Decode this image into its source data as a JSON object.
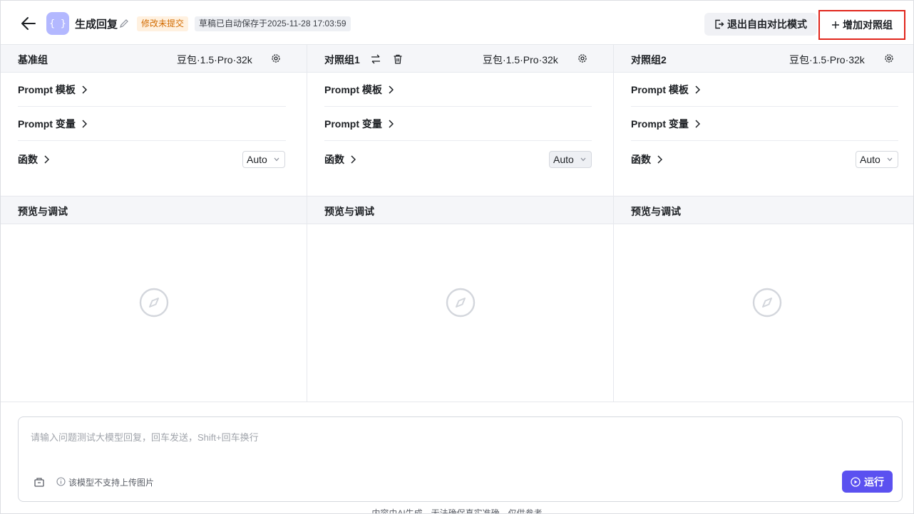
{
  "header": {
    "title": "生成回复",
    "app_icon_text": "{ }",
    "status_badge": "修改未提交",
    "draft_badge": "草稿已自动保存于2025-11-28 17:03:59",
    "exit_button": "退出自由对比模式",
    "add_button": "增加对照组"
  },
  "columns": [
    {
      "name": "基准组",
      "model": "豆包·1.5·Pro·32k",
      "rows": {
        "template": "Prompt 模板",
        "variables": "Prompt 变量",
        "functions": "函数"
      },
      "select_value": "Auto",
      "preview_title": "预览与调试"
    },
    {
      "name": "对照组1",
      "model": "豆包·1.5·Pro·32k",
      "rows": {
        "template": "Prompt 模板",
        "variables": "Prompt 变量",
        "functions": "函数"
      },
      "select_value": "Auto",
      "preview_title": "预览与调试"
    },
    {
      "name": "对照组2",
      "model": "豆包·1.5·Pro·32k",
      "rows": {
        "template": "Prompt 模板",
        "variables": "Prompt 变量",
        "functions": "函数"
      },
      "select_value": "Auto",
      "preview_title": "预览与调试"
    }
  ],
  "input": {
    "placeholder": "请输入问题测试大模型回复，回车发送，Shift+回车换行",
    "upload_hint": "该模型不支持上传图片",
    "run_button": "运行"
  },
  "footer": {
    "note": "内容由AI生成，无法确保真实准确，仅供参考"
  },
  "colors": {
    "accent": "#5b51f0",
    "highlight_border": "#e1251b",
    "modified_badge": "#d26b00"
  }
}
